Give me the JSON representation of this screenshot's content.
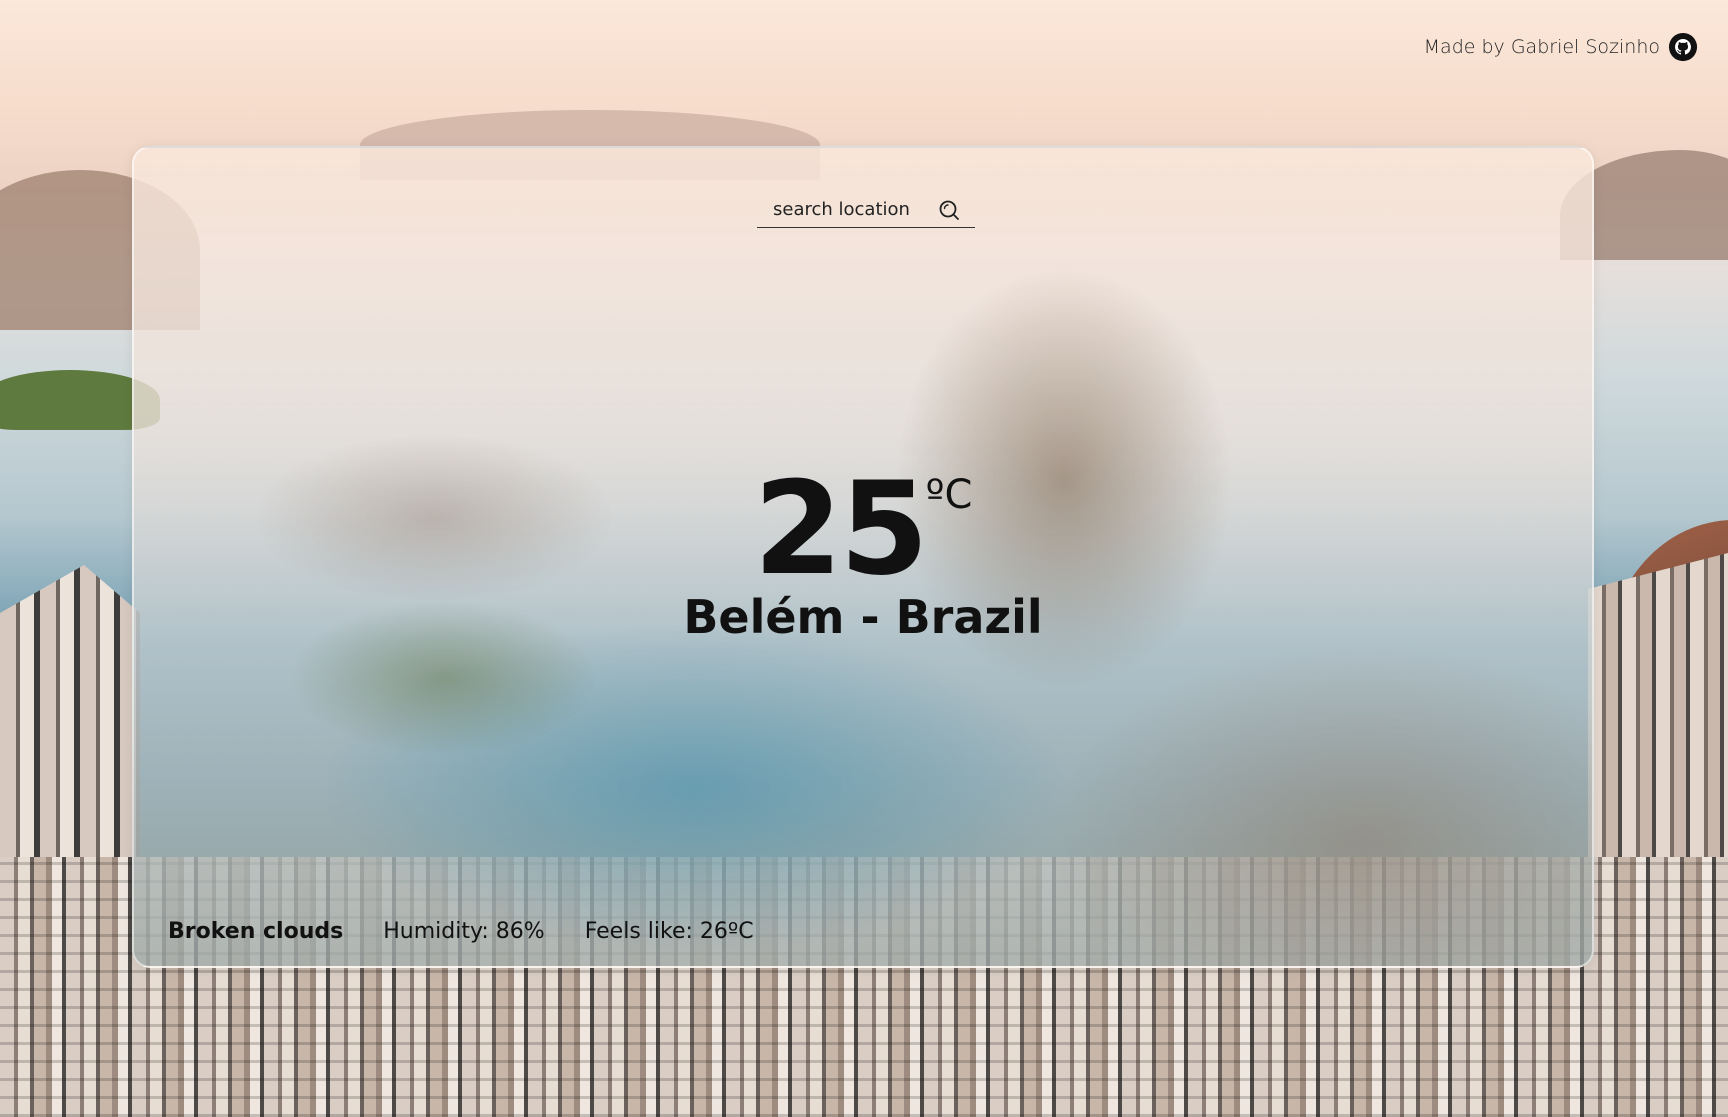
{
  "credit": {
    "text": "Made by Gabriel Sozinho",
    "icon": "github-icon"
  },
  "search": {
    "placeholder": "search location",
    "icon": "search-icon"
  },
  "weather": {
    "temperature": "25",
    "unit": "ºC",
    "location": "Belém - Brazil",
    "description": "Broken clouds",
    "humidity": "Humidity: 86%",
    "feels_like": "Feels like: 26ºC"
  },
  "colors": {
    "text": "#111111",
    "card_border": "#ffffff"
  }
}
